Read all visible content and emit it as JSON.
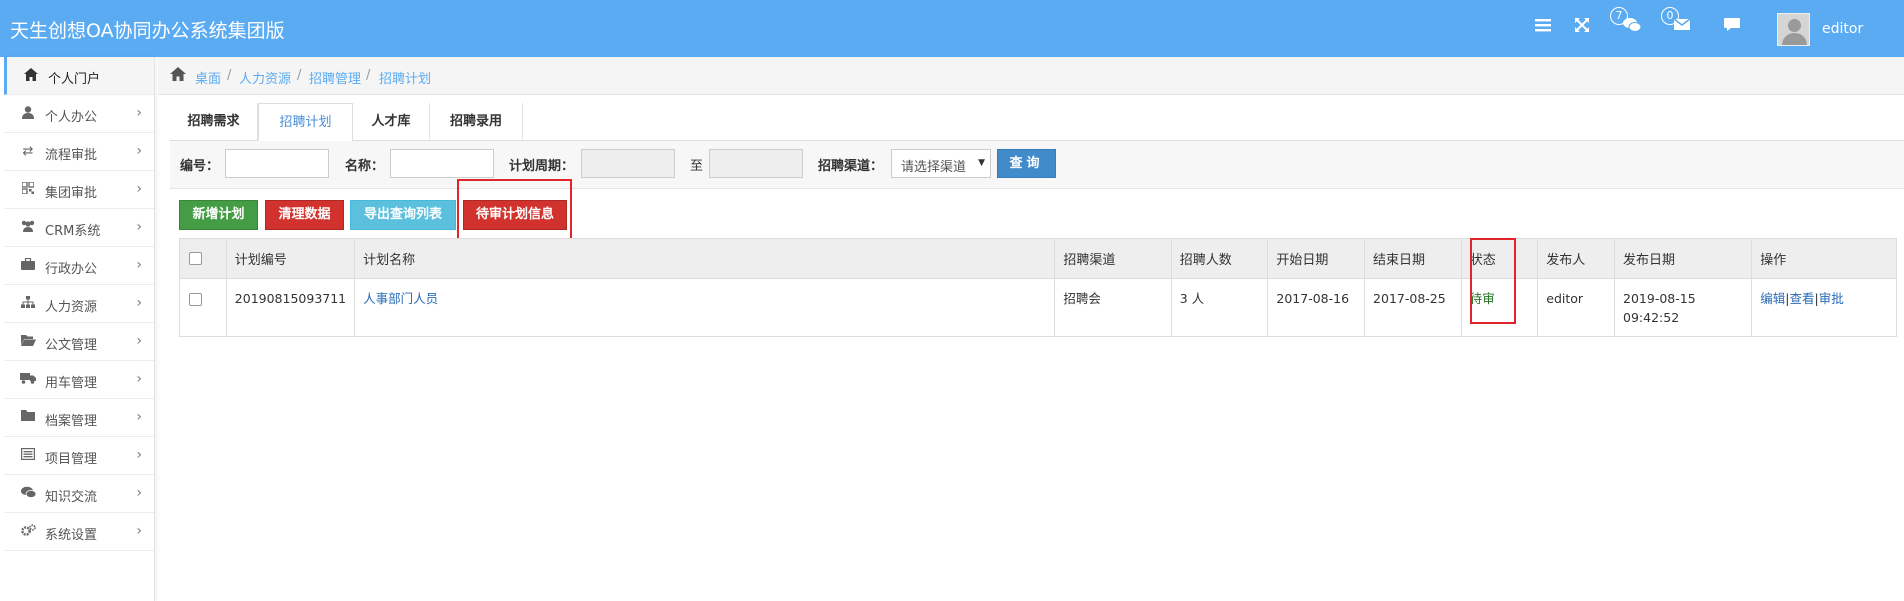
{
  "header": {
    "title": "天生创想OA协同办公系统集团版",
    "message_count": "7",
    "mail_count": "0",
    "username": "editor"
  },
  "sidebar": {
    "items": [
      {
        "label": "个人门户",
        "icon": "home-icon"
      },
      {
        "label": "个人办公",
        "icon": "user-icon"
      },
      {
        "label": "流程审批",
        "icon": "retweet-icon"
      },
      {
        "label": "集团审批",
        "icon": "qrcode-icon"
      },
      {
        "label": "CRM系统",
        "icon": "users-icon"
      },
      {
        "label": "行政办公",
        "icon": "briefcase-icon"
      },
      {
        "label": "人力资源",
        "icon": "sitemap-icon"
      },
      {
        "label": "公文管理",
        "icon": "folder-open-icon"
      },
      {
        "label": "用车管理",
        "icon": "truck-icon"
      },
      {
        "label": "档案管理",
        "icon": "folder-icon"
      },
      {
        "label": "项目管理",
        "icon": "list-alt-icon"
      },
      {
        "label": "知识交流",
        "icon": "comments-icon"
      },
      {
        "label": "系统设置",
        "icon": "cogs-icon"
      }
    ]
  },
  "breadcrumb": [
    "桌面",
    "人力资源",
    "招聘管理",
    "招聘计划"
  ],
  "tabs": [
    {
      "label": "招聘需求"
    },
    {
      "label": "招聘计划"
    },
    {
      "label": "人才库"
    },
    {
      "label": "招聘录用"
    }
  ],
  "search": {
    "code_label": "编号：",
    "name_label": "名称：",
    "period_label": "计划周期：",
    "to_label": "至",
    "channel_label": "招聘渠道：",
    "channel_value": "请选择渠道",
    "query_label": "查询"
  },
  "actions": {
    "add": "新增计划",
    "clear": "清理数据",
    "export": "导出查询列表",
    "pending": "待审计划信息"
  },
  "table": {
    "headers": [
      "计划编号",
      "计划名称",
      "招聘渠道",
      "招聘人数",
      "开始日期",
      "结束日期",
      "状态",
      "发布人",
      "发布日期",
      "操作"
    ],
    "rows": [
      {
        "code": "20190815093711",
        "name": "人事部门人员",
        "channel": "招聘会",
        "count": "3 人",
        "start": "2017-08-16",
        "end": "2017-08-25",
        "status": "待审",
        "publisher": "editor",
        "publish_date": "2019-08-15",
        "publish_time": "09:42:52",
        "op_edit": "编辑",
        "op_view": "查看",
        "op_approve": "审批"
      }
    ]
  },
  "colors": {
    "header_bg": "#5aabf2",
    "primary": "#428bca",
    "success": "#449d44",
    "danger": "#d2322d",
    "info": "#5bc0de",
    "highlight": "#e0262b"
  }
}
